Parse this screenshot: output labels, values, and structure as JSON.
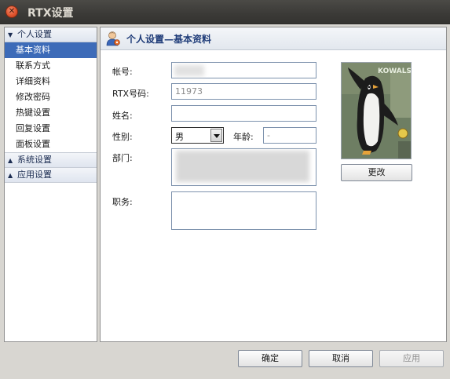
{
  "window": {
    "title": "RTX设置",
    "close_symbol": "✕"
  },
  "nav": {
    "groups": [
      {
        "label": "个人设置",
        "expanded": true,
        "items": [
          {
            "label": "基本资料",
            "selected": true
          },
          {
            "label": "联系方式"
          },
          {
            "label": "详细资料"
          },
          {
            "label": "修改密码"
          },
          {
            "label": "热键设置"
          },
          {
            "label": "回复设置"
          },
          {
            "label": "面板设置"
          }
        ]
      },
      {
        "label": "系统设置",
        "expanded": false
      },
      {
        "label": "应用设置",
        "expanded": false
      }
    ]
  },
  "panel": {
    "title": "个人设置—基本资料",
    "account_label": "帐号:",
    "rtx_label": "RTX号码:",
    "rtx_value": "11973",
    "name_label": "姓名:",
    "gender_label": "性别:",
    "gender_value": "男",
    "age_label": "年龄:",
    "age_value": "-",
    "dept_label": "部门:",
    "position_label": "职务:",
    "change_button": "更改",
    "avatar_text": "KOWALS"
  },
  "footer": {
    "ok": "确定",
    "cancel": "取消",
    "apply": "应用"
  },
  "colors": {
    "selected_bg": "#3d6bb8",
    "header_title": "#1e3b78",
    "titlebar": "#3b3a37",
    "close_button": "#e0542e"
  }
}
